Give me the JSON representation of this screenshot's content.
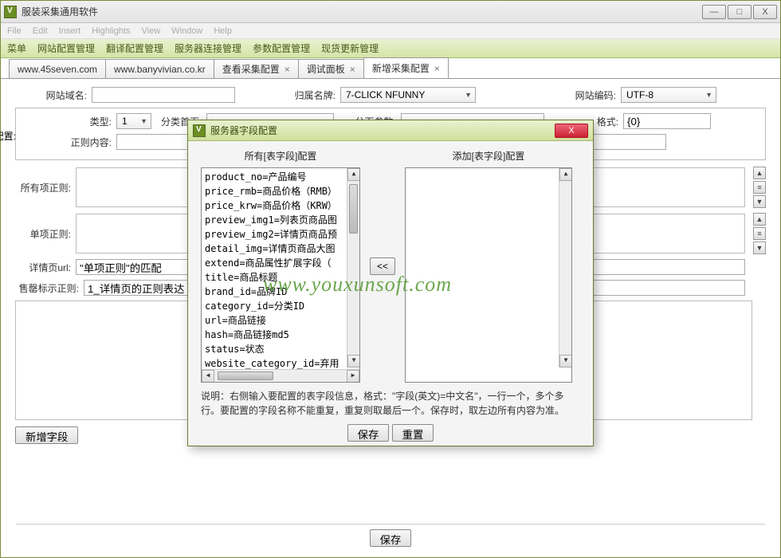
{
  "window": {
    "title": "服装采集通用软件"
  },
  "topmenu_faded": [
    "File",
    "Edit",
    "Insert",
    "Highlights",
    "View",
    "Window",
    "Help"
  ],
  "menubar": [
    "菜单",
    "网站配置管理",
    "翻译配置管理",
    "服务器连接管理",
    "参数配置管理",
    "现货更新管理"
  ],
  "tabs": [
    {
      "label": "www.45seven.com",
      "close": false
    },
    {
      "label": "www.banyvivian.co.kr",
      "close": false
    },
    {
      "label": "查看采集配置",
      "close": true
    },
    {
      "label": "调试面板",
      "close": true
    },
    {
      "label": "新增采集配置",
      "close": true,
      "active": true
    }
  ],
  "form": {
    "site_domain_label": "网站域名:",
    "brand_label": "归属名牌:",
    "brand_value": "7-CLICK NFUNNY",
    "encoding_label": "网站编码:",
    "encoding_value": "UTF-8",
    "category_config_label": "分类配置:",
    "type_label": "类型:",
    "type_value": "1",
    "category_home_label": "分类首页:",
    "paging_param_label": "分页参数:",
    "format_label": "格式:",
    "format_value": "{0}",
    "regex_content_label": "正则内容:",
    "all_items_regex_label": "所有项正则:",
    "single_item_regex_label": "单项正则:",
    "detail_url_label": "详情页url:",
    "detail_url_value": "\"单项正则\"的匹配",
    "soldout_label": "售罄标示正则:",
    "soldout_value": "1_详情页的正则表达",
    "add_field_btn": "新增字段",
    "save_btn": "保存"
  },
  "modal": {
    "title": "服务器字段配置",
    "left_head": "所有[表字段]配置",
    "right_head": "添加[表字段]配置",
    "fields": [
      "product_no=产品编号",
      "price_rmb=商品价格（RMB）",
      "price_krw=商品价格（KRW）",
      "preview_img1=列表页商品图",
      "preview_img2=详情页商品预",
      "detail_img=详情页商品大图",
      "extend=商品属性扩展字段（",
      "title=商品标题",
      "brand_id=品牌ID",
      "category_id=分类ID",
      "url=商品链接",
      "hash=商品链接md5",
      "status=状态",
      "website_category_id=弃用"
    ],
    "move_btn": "<<",
    "note": "说明：右侧输入要配置的表字段信息，格式：\"字段(英文)=中文名\"，一行一个，多个多行。要配置的字段名称不能重复，重复则取最后一个。保存时，取左边所有内容为准。",
    "save": "保存",
    "reset": "重置"
  },
  "watermark": "www.youxunsoft.com",
  "win_btns": {
    "min": "—",
    "max": "□",
    "close": "X"
  }
}
